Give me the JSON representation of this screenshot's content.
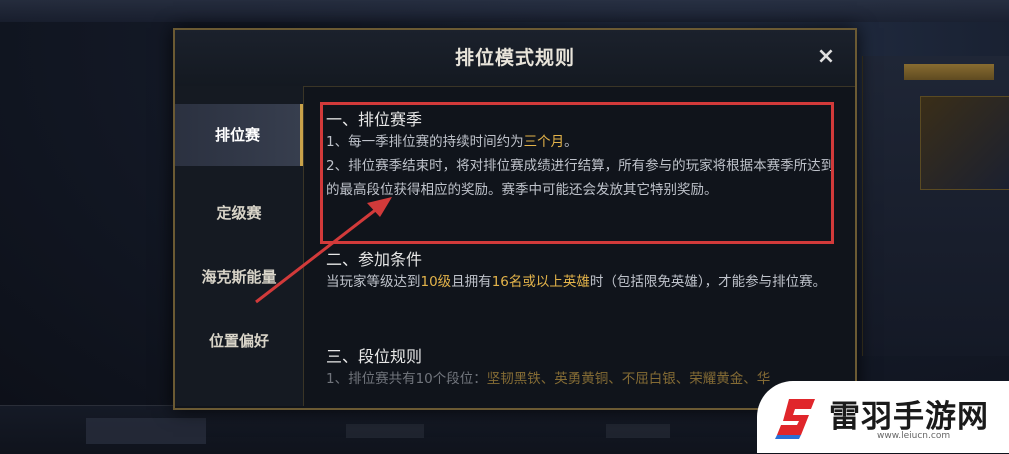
{
  "dialog": {
    "title": "排位模式规则",
    "close_label": "×"
  },
  "sidebar": {
    "items": [
      {
        "label": "排位赛",
        "active": true
      },
      {
        "label": "定级赛",
        "active": false
      },
      {
        "label": "海克斯能量",
        "active": false
      },
      {
        "label": "位置偏好",
        "active": false
      }
    ]
  },
  "content": {
    "section1": {
      "title": "一、排位赛季",
      "line1_prefix": "1、每一季排位赛的持续时间约为",
      "line1_highlight": "三个月",
      "line1_suffix": "。",
      "line2": "2、排位赛季结束时，将对排位赛成绩进行结算，所有参与的玩家将根据本赛季所达到的最高段位获得相应的奖励。赛季中可能还会发放其它特别奖励。"
    },
    "section2": {
      "title": "二、参加条件",
      "text_a": "当玩家等级达到",
      "hl_a": "10级",
      "text_b": "且拥有",
      "hl_b": "16名或以上英雄",
      "text_c": "时（包括限免英雄），才能参与排位赛。"
    },
    "section3": {
      "title": "三、段位规则",
      "text_a": "1、排位赛共有10个段位：",
      "hl_a": "坚韧黑铁、英勇黄铜、不屈白银、荣耀黄金、华"
    }
  },
  "watermark": {
    "name": "雷羽手游网",
    "url": "www.leiucn.com"
  },
  "colors": {
    "accent_gold": "#e3b34a",
    "highlight_red": "#d23a3a",
    "border_gold": "#6b5a33"
  }
}
